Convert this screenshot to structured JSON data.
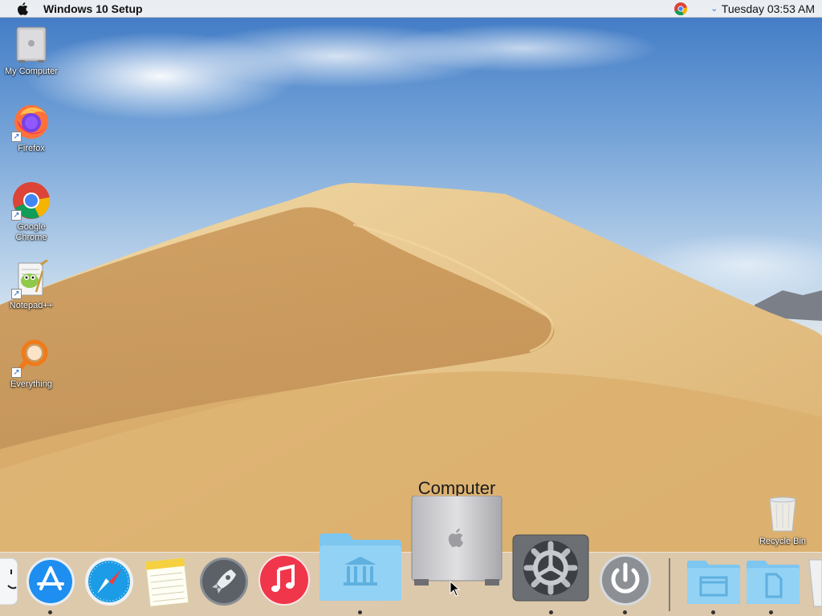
{
  "menubar": {
    "apple_icon": "apple-logo-icon",
    "app_title": "Windows 10 Setup",
    "tray_icons": [
      "chrome-icon",
      "chevron-down-icon"
    ],
    "clock": "Tuesday 03:53 AM"
  },
  "desktop": {
    "icons": [
      {
        "label": "My Computer",
        "icon": "mac-pro-icon"
      },
      {
        "label": "Firefox",
        "icon": "firefox-icon",
        "shortcut": true
      },
      {
        "label": "Google Chrome",
        "icon": "chrome-icon",
        "shortcut": true
      },
      {
        "label": "Notepad++",
        "icon": "notepadpp-icon",
        "shortcut": true
      },
      {
        "label": "Everything",
        "icon": "everything-search-icon",
        "shortcut": true
      },
      {
        "label": "Recycle Bin",
        "icon": "recycle-bin-icon"
      }
    ]
  },
  "dock": {
    "hover_label": "Computer",
    "items": [
      {
        "name": "finder",
        "icon": "finder-icon",
        "running": false
      },
      {
        "name": "app-store",
        "icon": "app-store-icon",
        "running": true
      },
      {
        "name": "safari",
        "icon": "safari-icon",
        "running": false
      },
      {
        "name": "notes",
        "icon": "notes-icon",
        "running": false
      },
      {
        "name": "launchpad",
        "icon": "rocket-icon",
        "running": false
      },
      {
        "name": "music",
        "icon": "music-note-icon",
        "running": false
      },
      {
        "name": "library-folder",
        "icon": "library-folder-icon",
        "running": true
      },
      {
        "name": "computer",
        "icon": "mac-pro-icon",
        "running": false
      },
      {
        "name": "system-preferences",
        "icon": "gear-icon",
        "running": true
      },
      {
        "name": "power",
        "icon": "power-icon",
        "running": true
      },
      {
        "name": "window-folder",
        "icon": "window-folder-icon",
        "running": true
      },
      {
        "name": "documents-folder",
        "icon": "document-folder-icon",
        "running": true
      },
      {
        "name": "trash",
        "icon": "trash-icon",
        "running": false
      }
    ]
  },
  "colors": {
    "menubar_bg": "#f5f5f5",
    "folder_blue": "#7cc6ef",
    "music_red": "#f0364a",
    "appstore_blue": "#1e8ef0",
    "sand": "#d8a964",
    "sky": "#6f9fd6"
  }
}
